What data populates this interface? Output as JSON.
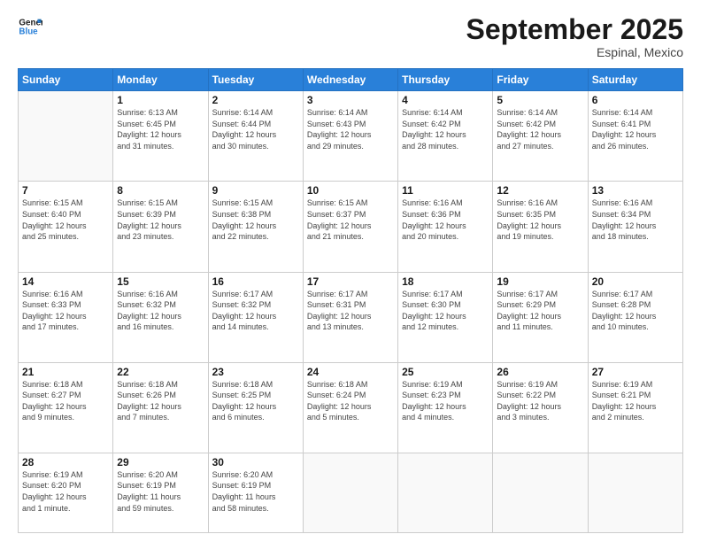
{
  "logo": {
    "line1": "General",
    "line2": "Blue"
  },
  "title": "September 2025",
  "subtitle": "Espinal, Mexico",
  "headers": [
    "Sunday",
    "Monday",
    "Tuesday",
    "Wednesday",
    "Thursday",
    "Friday",
    "Saturday"
  ],
  "weeks": [
    [
      {
        "day": "",
        "info": ""
      },
      {
        "day": "1",
        "info": "Sunrise: 6:13 AM\nSunset: 6:45 PM\nDaylight: 12 hours\nand 31 minutes."
      },
      {
        "day": "2",
        "info": "Sunrise: 6:14 AM\nSunset: 6:44 PM\nDaylight: 12 hours\nand 30 minutes."
      },
      {
        "day": "3",
        "info": "Sunrise: 6:14 AM\nSunset: 6:43 PM\nDaylight: 12 hours\nand 29 minutes."
      },
      {
        "day": "4",
        "info": "Sunrise: 6:14 AM\nSunset: 6:42 PM\nDaylight: 12 hours\nand 28 minutes."
      },
      {
        "day": "5",
        "info": "Sunrise: 6:14 AM\nSunset: 6:42 PM\nDaylight: 12 hours\nand 27 minutes."
      },
      {
        "day": "6",
        "info": "Sunrise: 6:14 AM\nSunset: 6:41 PM\nDaylight: 12 hours\nand 26 minutes."
      }
    ],
    [
      {
        "day": "7",
        "info": "Sunrise: 6:15 AM\nSunset: 6:40 PM\nDaylight: 12 hours\nand 25 minutes."
      },
      {
        "day": "8",
        "info": "Sunrise: 6:15 AM\nSunset: 6:39 PM\nDaylight: 12 hours\nand 23 minutes."
      },
      {
        "day": "9",
        "info": "Sunrise: 6:15 AM\nSunset: 6:38 PM\nDaylight: 12 hours\nand 22 minutes."
      },
      {
        "day": "10",
        "info": "Sunrise: 6:15 AM\nSunset: 6:37 PM\nDaylight: 12 hours\nand 21 minutes."
      },
      {
        "day": "11",
        "info": "Sunrise: 6:16 AM\nSunset: 6:36 PM\nDaylight: 12 hours\nand 20 minutes."
      },
      {
        "day": "12",
        "info": "Sunrise: 6:16 AM\nSunset: 6:35 PM\nDaylight: 12 hours\nand 19 minutes."
      },
      {
        "day": "13",
        "info": "Sunrise: 6:16 AM\nSunset: 6:34 PM\nDaylight: 12 hours\nand 18 minutes."
      }
    ],
    [
      {
        "day": "14",
        "info": "Sunrise: 6:16 AM\nSunset: 6:33 PM\nDaylight: 12 hours\nand 17 minutes."
      },
      {
        "day": "15",
        "info": "Sunrise: 6:16 AM\nSunset: 6:32 PM\nDaylight: 12 hours\nand 16 minutes."
      },
      {
        "day": "16",
        "info": "Sunrise: 6:17 AM\nSunset: 6:32 PM\nDaylight: 12 hours\nand 14 minutes."
      },
      {
        "day": "17",
        "info": "Sunrise: 6:17 AM\nSunset: 6:31 PM\nDaylight: 12 hours\nand 13 minutes."
      },
      {
        "day": "18",
        "info": "Sunrise: 6:17 AM\nSunset: 6:30 PM\nDaylight: 12 hours\nand 12 minutes."
      },
      {
        "day": "19",
        "info": "Sunrise: 6:17 AM\nSunset: 6:29 PM\nDaylight: 12 hours\nand 11 minutes."
      },
      {
        "day": "20",
        "info": "Sunrise: 6:17 AM\nSunset: 6:28 PM\nDaylight: 12 hours\nand 10 minutes."
      }
    ],
    [
      {
        "day": "21",
        "info": "Sunrise: 6:18 AM\nSunset: 6:27 PM\nDaylight: 12 hours\nand 9 minutes."
      },
      {
        "day": "22",
        "info": "Sunrise: 6:18 AM\nSunset: 6:26 PM\nDaylight: 12 hours\nand 7 minutes."
      },
      {
        "day": "23",
        "info": "Sunrise: 6:18 AM\nSunset: 6:25 PM\nDaylight: 12 hours\nand 6 minutes."
      },
      {
        "day": "24",
        "info": "Sunrise: 6:18 AM\nSunset: 6:24 PM\nDaylight: 12 hours\nand 5 minutes."
      },
      {
        "day": "25",
        "info": "Sunrise: 6:19 AM\nSunset: 6:23 PM\nDaylight: 12 hours\nand 4 minutes."
      },
      {
        "day": "26",
        "info": "Sunrise: 6:19 AM\nSunset: 6:22 PM\nDaylight: 12 hours\nand 3 minutes."
      },
      {
        "day": "27",
        "info": "Sunrise: 6:19 AM\nSunset: 6:21 PM\nDaylight: 12 hours\nand 2 minutes."
      }
    ],
    [
      {
        "day": "28",
        "info": "Sunrise: 6:19 AM\nSunset: 6:20 PM\nDaylight: 12 hours\nand 1 minute."
      },
      {
        "day": "29",
        "info": "Sunrise: 6:20 AM\nSunset: 6:19 PM\nDaylight: 11 hours\nand 59 minutes."
      },
      {
        "day": "30",
        "info": "Sunrise: 6:20 AM\nSunset: 6:19 PM\nDaylight: 11 hours\nand 58 minutes."
      },
      {
        "day": "",
        "info": ""
      },
      {
        "day": "",
        "info": ""
      },
      {
        "day": "",
        "info": ""
      },
      {
        "day": "",
        "info": ""
      }
    ]
  ]
}
